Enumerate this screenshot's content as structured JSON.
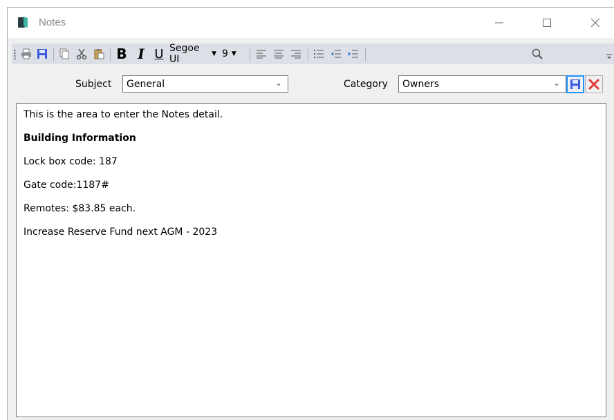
{
  "window": {
    "title": "Notes",
    "controls": {
      "minimize_icon": "minimize-icon",
      "maximize_icon": "maximize-icon",
      "close_icon": "close-icon"
    }
  },
  "toolbar": {
    "icons": [
      "print-icon",
      "save-icon",
      "copy-icon",
      "cut-icon",
      "paste-icon",
      "bold-icon",
      "italic-icon",
      "underline-icon",
      "align-left-icon",
      "align-center-icon",
      "align-right-icon",
      "bullet-list-icon",
      "outdent-icon",
      "indent-icon",
      "search-icon"
    ],
    "bold_label": "B",
    "italic_label": "I",
    "underline_label": "U",
    "font_name": "Segoe UI",
    "font_size": "9",
    "search_value": ""
  },
  "form": {
    "subject_label": "Subject",
    "subject_value": "General",
    "category_label": "Category",
    "category_value": "Owners",
    "save_icon": "save-icon",
    "delete_icon": "delete-icon"
  },
  "notes": {
    "line1": "This is the area to enter the Notes detail.",
    "heading": "Building Information",
    "line2": "Lock box code: 187",
    "line3": "Gate code:1187#",
    "line4": "Remotes: $83.85 each.",
    "line5": "Increase Reserve Fund next AGM - 2023"
  },
  "colors": {
    "accent": "#1e90ff",
    "save": "#3b5bdb",
    "delete": "#e53935",
    "toolbar_bg": "#dcdfe6",
    "window_bg": "#f0f0f0"
  }
}
